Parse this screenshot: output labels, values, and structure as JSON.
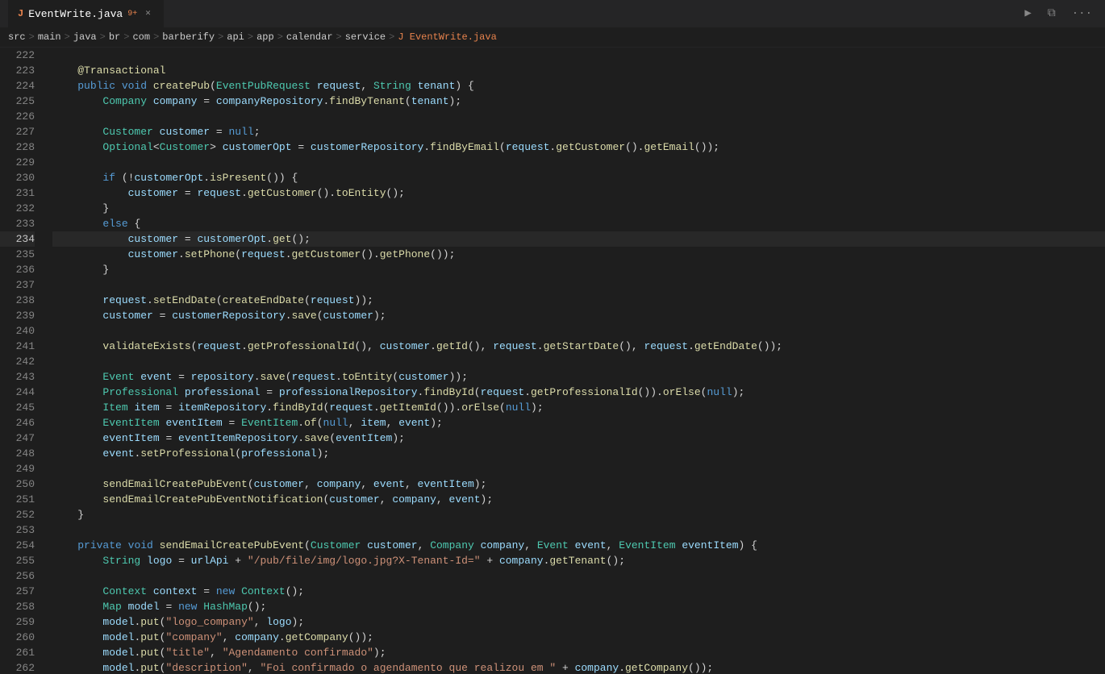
{
  "titleBar": {
    "tab": {
      "icon": "J",
      "label": "EventWrite.java",
      "modified": "9+",
      "active": true
    },
    "buttons": {
      "run": "▶",
      "split": "⧉",
      "more": "···"
    }
  },
  "breadcrumb": {
    "items": [
      "src",
      "main",
      "java",
      "br",
      "com",
      "barberify",
      "api",
      "app",
      "calendar",
      "service",
      "EventWrite.java"
    ]
  },
  "lines": {
    "start": 222,
    "active": 234,
    "count": 41
  }
}
